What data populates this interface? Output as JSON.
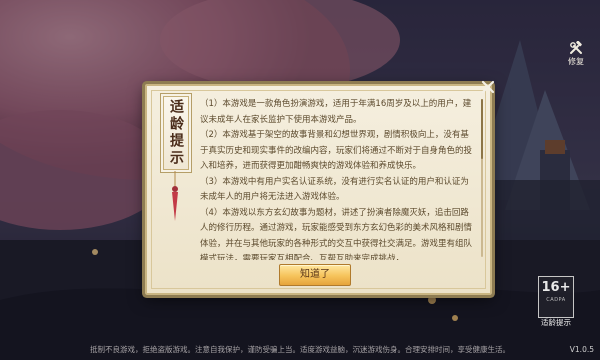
{
  "top_right_button": {
    "label": "修复",
    "icon": "hammer-wrench-icon"
  },
  "dialog": {
    "banner_title": "适龄提示",
    "paragraphs": [
      "（1）本游戏是一款角色扮演游戏，适用于年满16周岁及以上的用户，建议未成年人在家长监护下使用本游戏产品。",
      "（2）本游戏基于架空的故事背景和幻想世界观，剧情积极向上，没有基于真实历史和现实事件的改编内容，玩家们将通过不断对于自身角色的投入和培养，进而获得更加酣畅爽快的游戏体验和养成快乐。",
      "（3）本游戏中有用户实名认证系统，没有进行实名认证的用户和认证为未成年人的用户将无法进入游戏体验。",
      "（4）本游戏以东方玄幻故事为题材，讲述了扮演者除魔灭妖，追击回路人的修行历程。通过游戏，玩家能感受到东方玄幻色彩的美术风格和剧情体验，并在与其他玩家的各种形式的交互中获得社交满足。游戏里有组队模式玩法，需要玩家互相配合、互帮互助来完成挑战，"
    ],
    "confirm_label": "知道了",
    "close_icon": "close-icon"
  },
  "age_rating": {
    "number": "16+",
    "sub": "CADPA",
    "label": "适龄提示"
  },
  "footer": {
    "notice": "抵制不良游戏，拒绝盗版游戏。注意自我保护，谨防受骗上当。适度游戏益脑，沉迷游戏伤身。合理安排时间，享受健康生活。",
    "version": "V1.0.5"
  },
  "colors": {
    "accent": "#f6c35b",
    "dialog_bg": "#f3ecd9",
    "text": "#5c4a2d"
  }
}
